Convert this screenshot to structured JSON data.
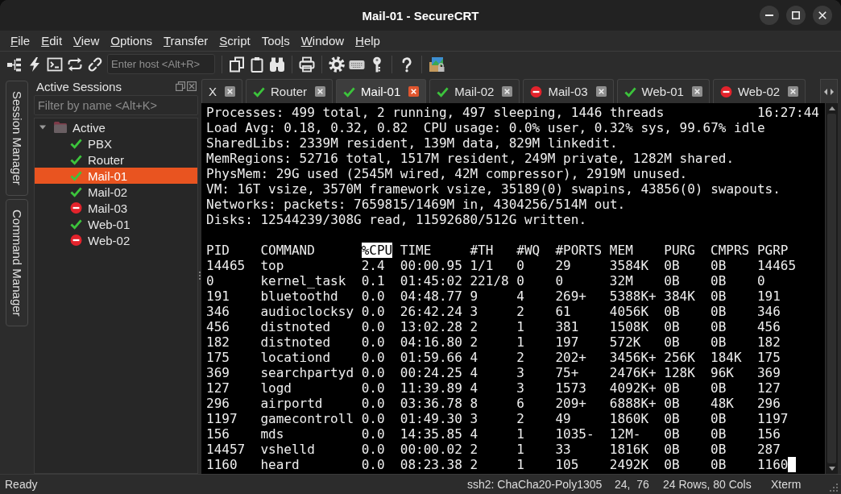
{
  "window": {
    "title": "Mail-01 - SecureCRT"
  },
  "menu": [
    {
      "key": "F",
      "rest": "ile"
    },
    {
      "key": "E",
      "rest": "dit"
    },
    {
      "key": "V",
      "rest": "iew"
    },
    {
      "key": "O",
      "rest": "ptions"
    },
    {
      "key": "T",
      "rest": "ransfer"
    },
    {
      "key": "S",
      "rest": "cript"
    },
    {
      "lead": "Too",
      "key": "l",
      "rest": "s"
    },
    {
      "key": "W",
      "rest": "indow"
    },
    {
      "key": "H",
      "rest": "elp"
    }
  ],
  "toolbar": {
    "host_field": {
      "placeholder": "Enter host <Alt+R>"
    }
  },
  "side_tabs": [
    {
      "label": "Session Manager"
    },
    {
      "label": "Command Manager"
    }
  ],
  "sessions_panel": {
    "title": "Active Sessions",
    "filter": {
      "placeholder": "Filter by name <Alt+K>"
    },
    "tree": [
      {
        "label": "Active",
        "expanded": true,
        "selected": false,
        "children": [
          {
            "label": "PBX",
            "connected": true,
            "selected": false
          },
          {
            "label": "Router",
            "connected": true,
            "selected": false
          },
          {
            "label": "Mail-01",
            "connected": true,
            "selected": true
          },
          {
            "label": "Mail-02",
            "connected": true,
            "selected": false
          },
          {
            "label": "Mail-03",
            "connected": false,
            "selected": false
          },
          {
            "label": "Web-01",
            "connected": true,
            "selected": false
          },
          {
            "label": "Web-02",
            "connected": false,
            "selected": false
          }
        ]
      }
    ]
  },
  "tabs": [
    {
      "label": "X",
      "selected": false
    },
    {
      "label": "Router",
      "connected": true,
      "selected": false
    },
    {
      "label": "Mail-01",
      "connected": true,
      "selected": true
    },
    {
      "label": "Mail-02",
      "connected": true,
      "selected": false
    },
    {
      "label": "Mail-03",
      "connected": false,
      "selected": false
    },
    {
      "label": "Web-01",
      "connected": true,
      "selected": false
    },
    {
      "label": "Web-02",
      "connected": false,
      "selected": false
    }
  ],
  "terminal": {
    "summary_lines": [
      "Processes: 499 total, 2 running, 497 sleeping, 1446 threads",
      "Load Avg: 0.18, 0.32, 0.82  CPU usage: 0.0% user, 0.32% sys, 99.67% idle",
      "SharedLibs: 2339M resident, 139M data, 829M linkedit.",
      "MemRegions: 52716 total, 1517M resident, 249M private, 1282M shared.",
      "PhysMem: 29G used (2545M wired, 42M compressor), 2919M unused.",
      "VM: 16T vsize, 3570M framework vsize, 35189(0) swapins, 43856(0) swapouts.",
      "Networks: packets: 7659815/1469M in, 4304256/514M out.",
      "Disks: 12544239/308G read, 11592680/512G written."
    ],
    "clock": "16:27:44",
    "table": {
      "columns": [
        {
          "label": "PID",
          "highlighted": false
        },
        {
          "label": "COMMAND",
          "highlighted": false
        },
        {
          "label": "%CPU",
          "highlighted": true
        },
        {
          "label": "TIME",
          "highlighted": false
        },
        {
          "label": "#TH",
          "highlighted": false
        },
        {
          "label": "#WQ",
          "highlighted": false
        },
        {
          "label": "#PORTS",
          "highlighted": false
        },
        {
          "label": "MEM",
          "highlighted": false
        },
        {
          "label": "PURG",
          "highlighted": false
        },
        {
          "label": "CMPRS",
          "highlighted": false
        },
        {
          "label": "PGRP",
          "highlighted": false
        }
      ],
      "rows": [
        [
          "14465",
          "top",
          "2.4",
          "00:00.95",
          "1/1",
          "0",
          "29",
          "3584K",
          "0B",
          "0B",
          "14465"
        ],
        [
          "0",
          "kernel_task",
          "0.1",
          "01:45:02",
          "221/8",
          "0",
          "0",
          "32M",
          "0B",
          "0B",
          "0"
        ],
        [
          "191",
          "bluetoothd",
          "0.0",
          "04:48.77",
          "9",
          "4",
          "269+",
          "5388K+",
          "384K",
          "0B",
          "191"
        ],
        [
          "346",
          "audioclocksy",
          "0.0",
          "26:42.24",
          "3",
          "2",
          "61",
          "4056K",
          "0B",
          "0B",
          "346"
        ],
        [
          "456",
          "distnoted",
          "0.0",
          "13:02.28",
          "2",
          "1",
          "381",
          "1508K",
          "0B",
          "0B",
          "456"
        ],
        [
          "182",
          "distnoted",
          "0.0",
          "04:16.80",
          "2",
          "1",
          "197",
          "572K",
          "0B",
          "0B",
          "182"
        ],
        [
          "175",
          "locationd",
          "0.0",
          "01:59.66",
          "4",
          "2",
          "202+",
          "3456K+",
          "256K",
          "184K",
          "175"
        ],
        [
          "369",
          "searchpartyd",
          "0.0",
          "00:24.25",
          "4",
          "3",
          "75+",
          "2476K+",
          "128K",
          "96K",
          "369"
        ],
        [
          "127",
          "logd",
          "0.0",
          "11:39.89",
          "4",
          "3",
          "1573",
          "4092K+",
          "0B",
          "0B",
          "127"
        ],
        [
          "296",
          "airportd",
          "0.0",
          "03:36.78",
          "8",
          "6",
          "209+",
          "6888K+",
          "0B",
          "48K",
          "296"
        ],
        [
          "1197",
          "gamecontroll",
          "0.0",
          "01:49.30",
          "3",
          "2",
          "49",
          "1860K",
          "0B",
          "0B",
          "1197"
        ],
        [
          "156",
          "mds",
          "0.0",
          "14:35.85",
          "4",
          "1",
          "1035-",
          "12M-",
          "0B",
          "0B",
          "156"
        ],
        [
          "14457",
          "vshelld",
          "0.0",
          "00:00.02",
          "2",
          "1",
          "33",
          "1816K",
          "0B",
          "0B",
          "287"
        ],
        [
          "1160",
          "heard",
          "0.0",
          "08:23.38",
          "2",
          "1",
          "105",
          "2492K",
          "0B",
          "0B",
          "1160"
        ]
      ]
    },
    "cursor": true
  },
  "status_bar": {
    "message": "Ready",
    "panes": [
      "ssh2: ChaCha20-Poly1305",
      "24,  76",
      "24 Rows, 80 Cols",
      "Xterm"
    ]
  }
}
